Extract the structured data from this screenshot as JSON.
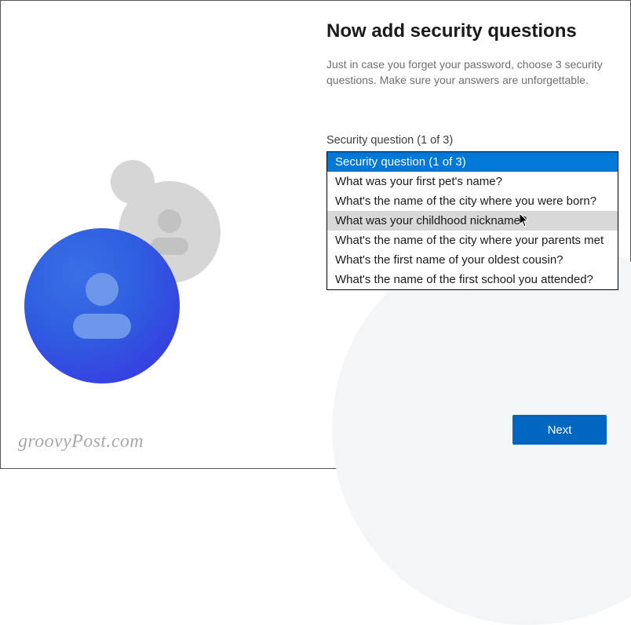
{
  "page": {
    "title": "Now add security questions",
    "subtitle": "Just in case you forget your password, choose 3 security questions. Make sure your answers are unforgettable."
  },
  "field": {
    "label": "Security question (1 of 3)"
  },
  "dropdown": {
    "options": [
      "Security question (1 of 3)",
      "What was your first pet's name?",
      "What's the name of the city where you were born?",
      "What was your childhood nickname?",
      "What's the name of the city where your parents met",
      "What's the first name of your oldest cousin?",
      "What's the name of the first school you attended?"
    ],
    "selected_index": 0,
    "hover_index": 3
  },
  "buttons": {
    "next": "Next"
  },
  "watermark": "groovyPost.com",
  "colors": {
    "accent": "#0067c0",
    "selection": "#0078d7"
  }
}
